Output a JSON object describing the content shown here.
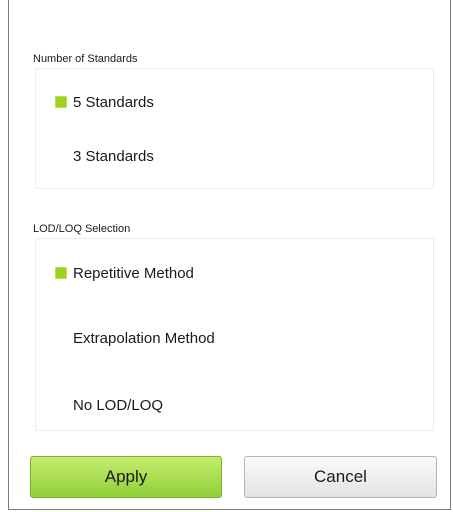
{
  "standards_section": {
    "label": "Number of Standards",
    "options": [
      {
        "label": "5 Standards",
        "selected": true
      },
      {
        "label": "3 Standards",
        "selected": false
      }
    ]
  },
  "lod_section": {
    "label": "LOD/LOQ Selection",
    "options": [
      {
        "label": "Repetitive Method",
        "selected": true
      },
      {
        "label": "Extrapolation Method",
        "selected": false
      },
      {
        "label": "No LOD/LOQ",
        "selected": false
      }
    ]
  },
  "actions": {
    "apply_label": "Apply",
    "cancel_label": "Cancel"
  },
  "colors": {
    "accent": "#9fd21c",
    "apply_button": "#a8dc4e"
  }
}
